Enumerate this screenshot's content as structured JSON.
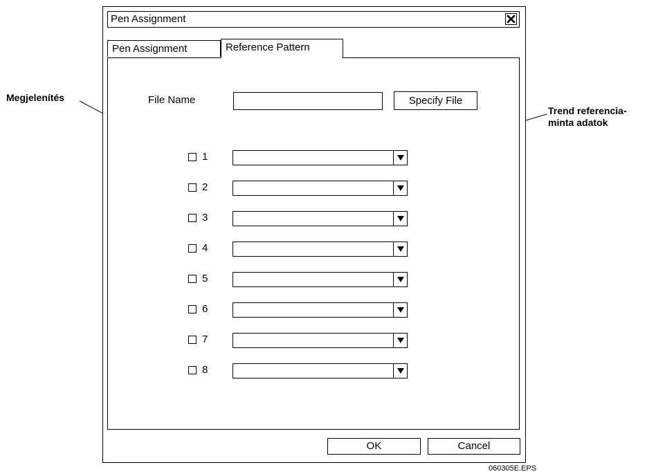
{
  "dialog": {
    "title": "Pen Assignment",
    "tabs": [
      {
        "label": "Pen Assignment",
        "active": false
      },
      {
        "label": "Reference Pattern",
        "active": true
      }
    ],
    "file_name_label": "File Name",
    "file_name_value": "",
    "specify_file_label": "Specify File",
    "pens": [
      {
        "number": "1",
        "checked": false,
        "selection": ""
      },
      {
        "number": "2",
        "checked": false,
        "selection": ""
      },
      {
        "number": "3",
        "checked": false,
        "selection": ""
      },
      {
        "number": "4",
        "checked": false,
        "selection": ""
      },
      {
        "number": "5",
        "checked": false,
        "selection": ""
      },
      {
        "number": "6",
        "checked": false,
        "selection": ""
      },
      {
        "number": "7",
        "checked": false,
        "selection": ""
      },
      {
        "number": "8",
        "checked": false,
        "selection": ""
      }
    ],
    "ok_label": "OK",
    "cancel_label": "Cancel"
  },
  "annotations": {
    "left": "Megjelenítés",
    "right_line1": "Trend referencia-",
    "right_line2": "minta adatok"
  },
  "figure_ref": "060305E.EPS"
}
